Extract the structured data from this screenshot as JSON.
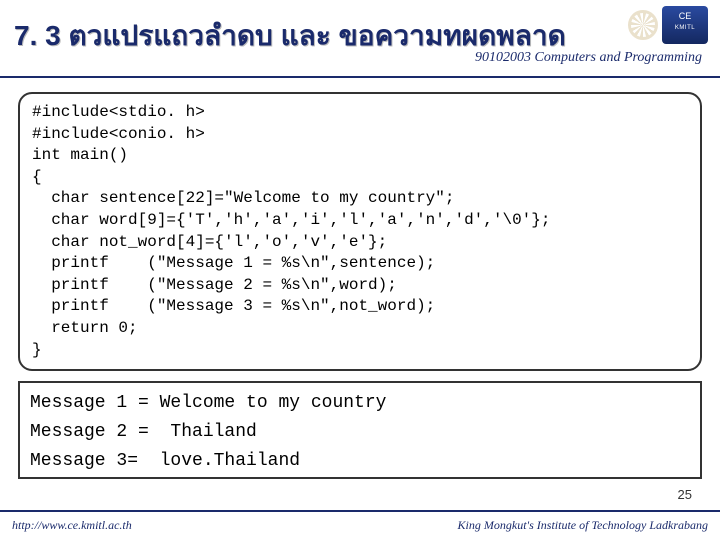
{
  "header": {
    "title": "7. 3 ตวแปรแถวลำดบ   และ ขอความทผดพลาด",
    "subtitle": "90102003 Computers and Programming",
    "logo_top": "CE",
    "logo_sub": "KMITL"
  },
  "code": "#include<stdio. h>\n#include<conio. h>\nint main()\n{\n  char sentence[22]=\"Welcome to my country\";\n  char word[9]={'T','h','a','i','l','a','n','d','\\0'};\n  char not_word[4]={'l','o','v','e'};\n  printf    (\"Message 1 = %s\\n\",sentence);\n  printf    (\"Message 2 = %s\\n\",word);\n  printf    (\"Message 3 = %s\\n\",not_word);\n  return 0;\n}",
  "output": "Message 1 = Welcome to my country\nMessage 2 =  Thailand\nMessage 3=  love.Thailand",
  "footer": {
    "left": "http://www.ce.kmitl.ac.th",
    "right": "King Mongkut's Institute of Technology Ladkrabang"
  },
  "page_number": "25"
}
